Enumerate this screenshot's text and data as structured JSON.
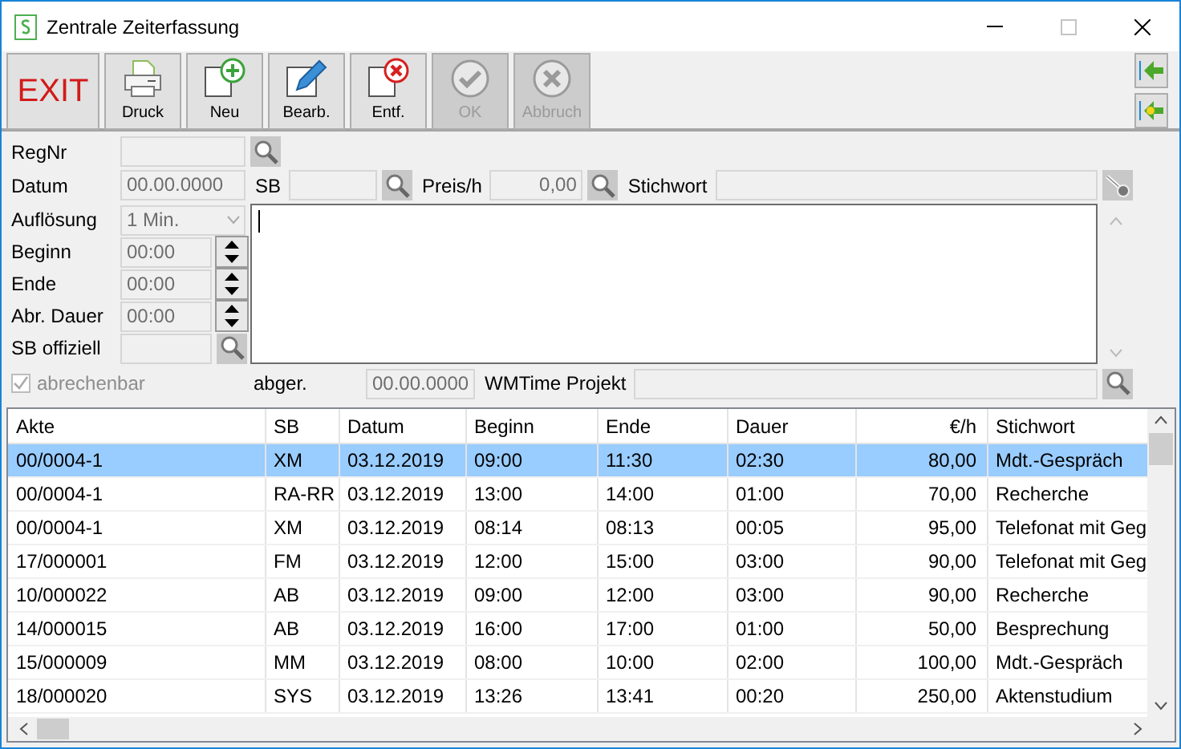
{
  "window": {
    "title": "Zentrale Zeiterfassung"
  },
  "toolbar": [
    {
      "label": "EXIT",
      "kind": "exit",
      "disabled": false
    },
    {
      "label": "Druck",
      "kind": "print",
      "disabled": false
    },
    {
      "label": "Neu",
      "kind": "add",
      "disabled": false
    },
    {
      "label": "Bearb.",
      "kind": "edit",
      "disabled": false
    },
    {
      "label": "Entf.",
      "kind": "delete",
      "disabled": false
    },
    {
      "label": "OK",
      "kind": "confirm",
      "disabled": true
    },
    {
      "label": "Abbruch",
      "kind": "cancel",
      "disabled": true
    }
  ],
  "form": {
    "regnr": {
      "label": "RegNr"
    },
    "datum": {
      "label": "Datum",
      "value": "00.00.0000"
    },
    "sb": {
      "label": "SB"
    },
    "preis": {
      "label": "Preis/h",
      "value": "0,00"
    },
    "stichwort": {
      "label": "Stichwort"
    },
    "aufloesung": {
      "label": "Auflösung",
      "value": "1 Min."
    },
    "times": [
      {
        "label": "Beginn",
        "value": "00:00"
      },
      {
        "label": "Ende",
        "value": "00:00"
      },
      {
        "label": "Abr. Dauer",
        "value": "00:00"
      }
    ],
    "sb_offiziell": {
      "label": "SB offiziell"
    },
    "abrechenbar": {
      "label": "abrechenbar",
      "checked": true,
      "disabled": true
    },
    "abger": {
      "label": "abger.",
      "value": "00.00.0000"
    },
    "projekt": {
      "label": "WMTime Projekt"
    }
  },
  "table": {
    "columns": [
      {
        "label": "Akte",
        "kind": "text"
      },
      {
        "label": "SB",
        "kind": "text"
      },
      {
        "label": "Datum",
        "kind": "text"
      },
      {
        "label": "Beginn",
        "kind": "text"
      },
      {
        "label": "Ende",
        "kind": "text"
      },
      {
        "label": "Dauer",
        "kind": "text"
      },
      {
        "label": "€/h",
        "kind": "number"
      },
      {
        "label": "Stichwort",
        "kind": "text"
      }
    ],
    "rows": [
      {
        "cells": [
          "00/0004-1",
          "XM",
          "03.12.2019",
          "09:00",
          "11:30",
          "02:30",
          "80,00",
          "Mdt.-Gespräch"
        ],
        "selected": true
      },
      {
        "cells": [
          "00/0004-1",
          "RA-RR",
          "03.12.2019",
          "13:00",
          "14:00",
          "01:00",
          "70,00",
          "Recherche"
        ],
        "selected": false
      },
      {
        "cells": [
          "00/0004-1",
          "XM",
          "03.12.2019",
          "08:14",
          "08:13",
          "00:05",
          "95,00",
          "Telefonat mit Geg"
        ],
        "selected": false
      },
      {
        "cells": [
          "17/000001",
          "FM",
          "03.12.2019",
          "12:00",
          "15:00",
          "03:00",
          "90,00",
          "Telefonat mit Geg"
        ],
        "selected": false
      },
      {
        "cells": [
          "10/000022",
          "AB",
          "03.12.2019",
          "09:00",
          "12:00",
          "03:00",
          "90,00",
          "Recherche"
        ],
        "selected": false
      },
      {
        "cells": [
          "14/000015",
          "AB",
          "03.12.2019",
          "16:00",
          "17:00",
          "01:00",
          "50,00",
          "Besprechung"
        ],
        "selected": false
      },
      {
        "cells": [
          "15/000009",
          "MM",
          "03.12.2019",
          "08:00",
          "10:00",
          "02:00",
          "100,00",
          "Mdt.-Gespräch"
        ],
        "selected": false
      },
      {
        "cells": [
          "18/000020",
          "SYS",
          "03.12.2019",
          "13:26",
          "13:41",
          "00:20",
          "250,00",
          "Aktenstudium"
        ],
        "selected": false
      }
    ]
  }
}
